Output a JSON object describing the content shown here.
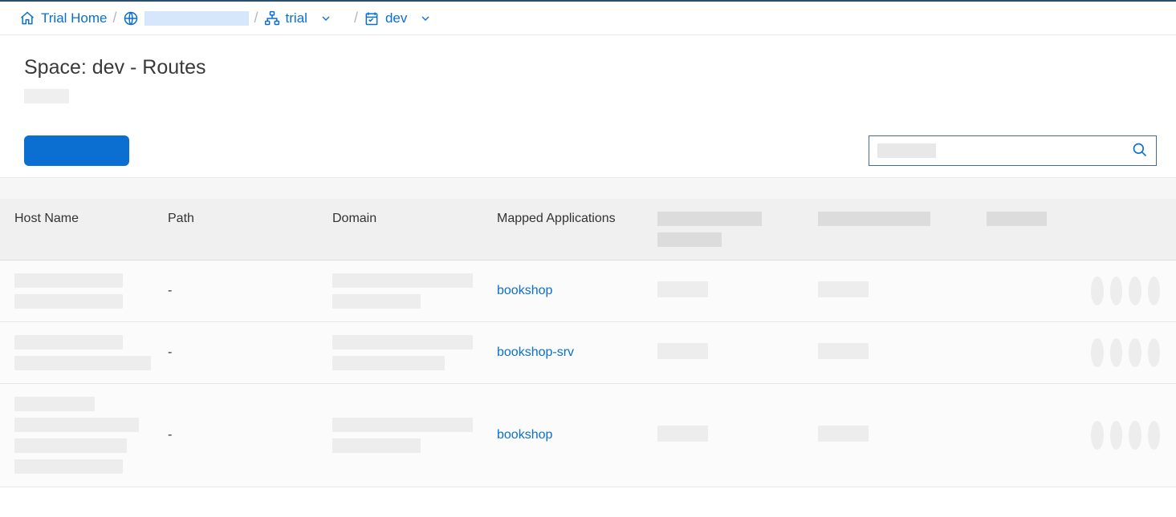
{
  "breadcrumb": {
    "home": "Trial Home",
    "org_redacted": true,
    "trial": "trial",
    "dev": "dev"
  },
  "page_title": "Space: dev - Routes",
  "toolbar": {
    "primary_button_label": "",
    "search_placeholder": ""
  },
  "columns": {
    "host": "Host Name",
    "path": "Path",
    "domain": "Domain",
    "mapped": "Mapped Applications",
    "r1_redacted": true,
    "r2_redacted": true,
    "r3_redacted": true
  },
  "rows": [
    {
      "path": "-",
      "mapped_app": "bookshop"
    },
    {
      "path": "-",
      "mapped_app": "bookshop-srv"
    },
    {
      "path": "-",
      "mapped_app": "bookshop"
    }
  ]
}
